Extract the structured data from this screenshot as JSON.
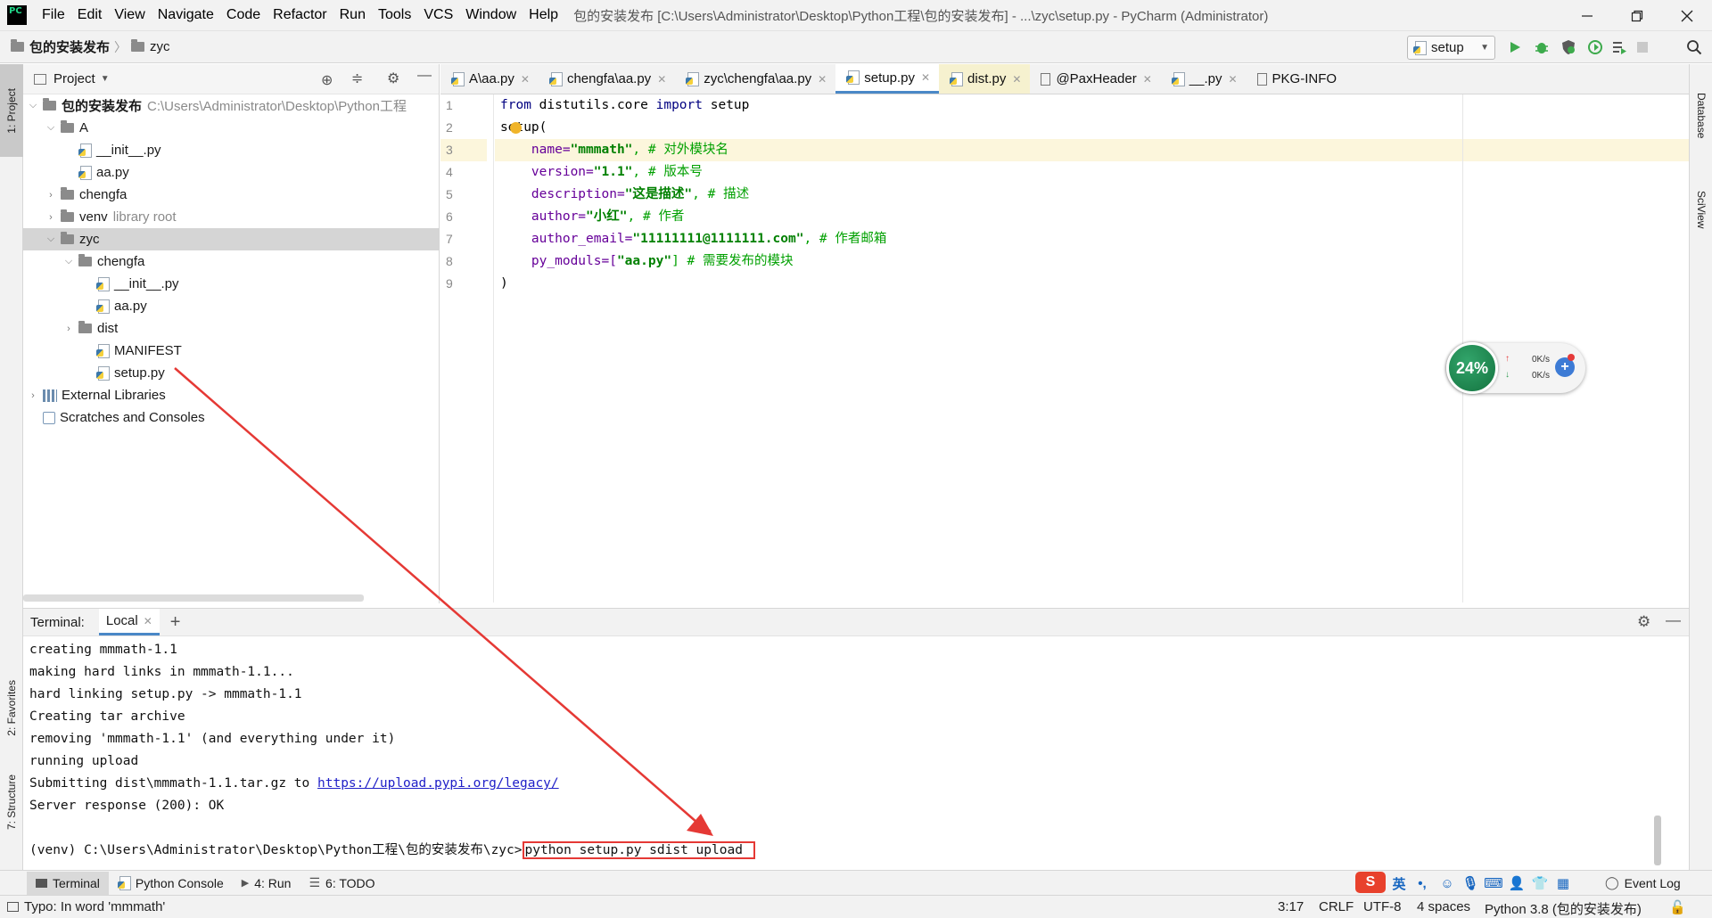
{
  "menu": {
    "items": [
      "File",
      "Edit",
      "View",
      "Navigate",
      "Code",
      "Refactor",
      "Run",
      "Tools",
      "VCS",
      "Window",
      "Help"
    ],
    "window_title": "包的安装发布 [C:\\Users\\Administrator\\Desktop\\Python工程\\包的安装发布] - ...\\zyc\\setup.py - PyCharm (Administrator)"
  },
  "navbar": {
    "crumbs": [
      "包的安装发布",
      "zyc"
    ],
    "run_config": "setup"
  },
  "left_stripe": {
    "project": "1: Project",
    "favorites": "2: Favorites",
    "structure": "7: Structure"
  },
  "right_stripe": {
    "database": "Database",
    "sciview": "SciView"
  },
  "project": {
    "header": "Project",
    "tree": [
      {
        "label": "包的安装发布",
        "hint": "C:\\Users\\Administrator\\Desktop\\Python工程"
      },
      {
        "label": "A"
      },
      {
        "label": "__init__.py"
      },
      {
        "label": "aa.py"
      },
      {
        "label": "chengfa"
      },
      {
        "label": "venv",
        "hint": "library root"
      },
      {
        "label": "zyc"
      },
      {
        "label": "chengfa"
      },
      {
        "label": "__init__.py"
      },
      {
        "label": "aa.py"
      },
      {
        "label": "dist"
      },
      {
        "label": "MANIFEST"
      },
      {
        "label": "setup.py"
      },
      {
        "label": "External Libraries"
      },
      {
        "label": "Scratches and Consoles"
      }
    ]
  },
  "editor": {
    "tabs": [
      "A\\aa.py",
      "chengfa\\aa.py",
      "zyc\\chengfa\\aa.py",
      "setup.py",
      "dist.py",
      "@PaxHeader",
      "__.py",
      "PKG-INFO"
    ],
    "line_numbers": [
      "1",
      "2",
      "3",
      "4",
      "5",
      "6",
      "7",
      "8",
      "9"
    ],
    "code": {
      "l1_from": "from",
      "l1_mod": " distutils.core ",
      "l1_import": "import",
      "l1_name": " setup",
      "l2": "setup(",
      "l3_key": "    name=",
      "l3_val": "\"mmmath\"",
      "l3_cmt": ", # 对外模块名",
      "l4_key": "    version=",
      "l4_val": "\"1.1\"",
      "l4_cmt": ", # 版本号",
      "l5_key": "    description=",
      "l5_val": "\"这是描述\"",
      "l5_cmt": ", # 描述",
      "l6_key": "    author=",
      "l6_val": "\"小红\"",
      "l6_cmt": ", # 作者",
      "l7_key": "    author_email=",
      "l7_val": "\"11111111@1111111.com\"",
      "l7_cmt": ", # 作者邮箱",
      "l8_key": "    py_moduls=[",
      "l8_val": "\"aa.py\"",
      "l8_cmt": "] # 需要发布的模块",
      "l9": ")"
    }
  },
  "net_widget": {
    "percent": "24%",
    "up": "0K/s",
    "down": "0K/s"
  },
  "terminal": {
    "label": "Terminal:",
    "tab": "Local",
    "lines": [
      "creating mmmath-1.1",
      "making hard links in mmmath-1.1...",
      "hard linking setup.py -> mmmath-1.1",
      "Creating tar archive",
      "removing 'mmmath-1.1' (and everything under it)",
      "running upload"
    ],
    "submit_prefix": "Submitting dist\\mmmath-1.1.tar.gz to ",
    "submit_link": "https://upload.pypi.org/legacy/",
    "response": "Server response (200): OK",
    "prompt": "(venv) C:\\Users\\Administrator\\Desktop\\Python工程\\包的安装发布\\zyc>",
    "command": "python setup.py sdist upload"
  },
  "toolwindows": {
    "terminal": "Terminal",
    "python_console": "Python Console",
    "run": "4: Run",
    "todo": "6: TODO",
    "event_log": "Event Log"
  },
  "ime": {
    "lang": "英"
  },
  "status": {
    "message": "Typo: In word 'mmmath'",
    "position": "3:17",
    "line_sep": "CRLF",
    "encoding": "UTF-8",
    "indent": "4 spaces",
    "interpreter": "Python 3.8 (包的安装发布)"
  },
  "colors": {
    "annotation": "#e53935",
    "accent": "#4a88c7"
  }
}
